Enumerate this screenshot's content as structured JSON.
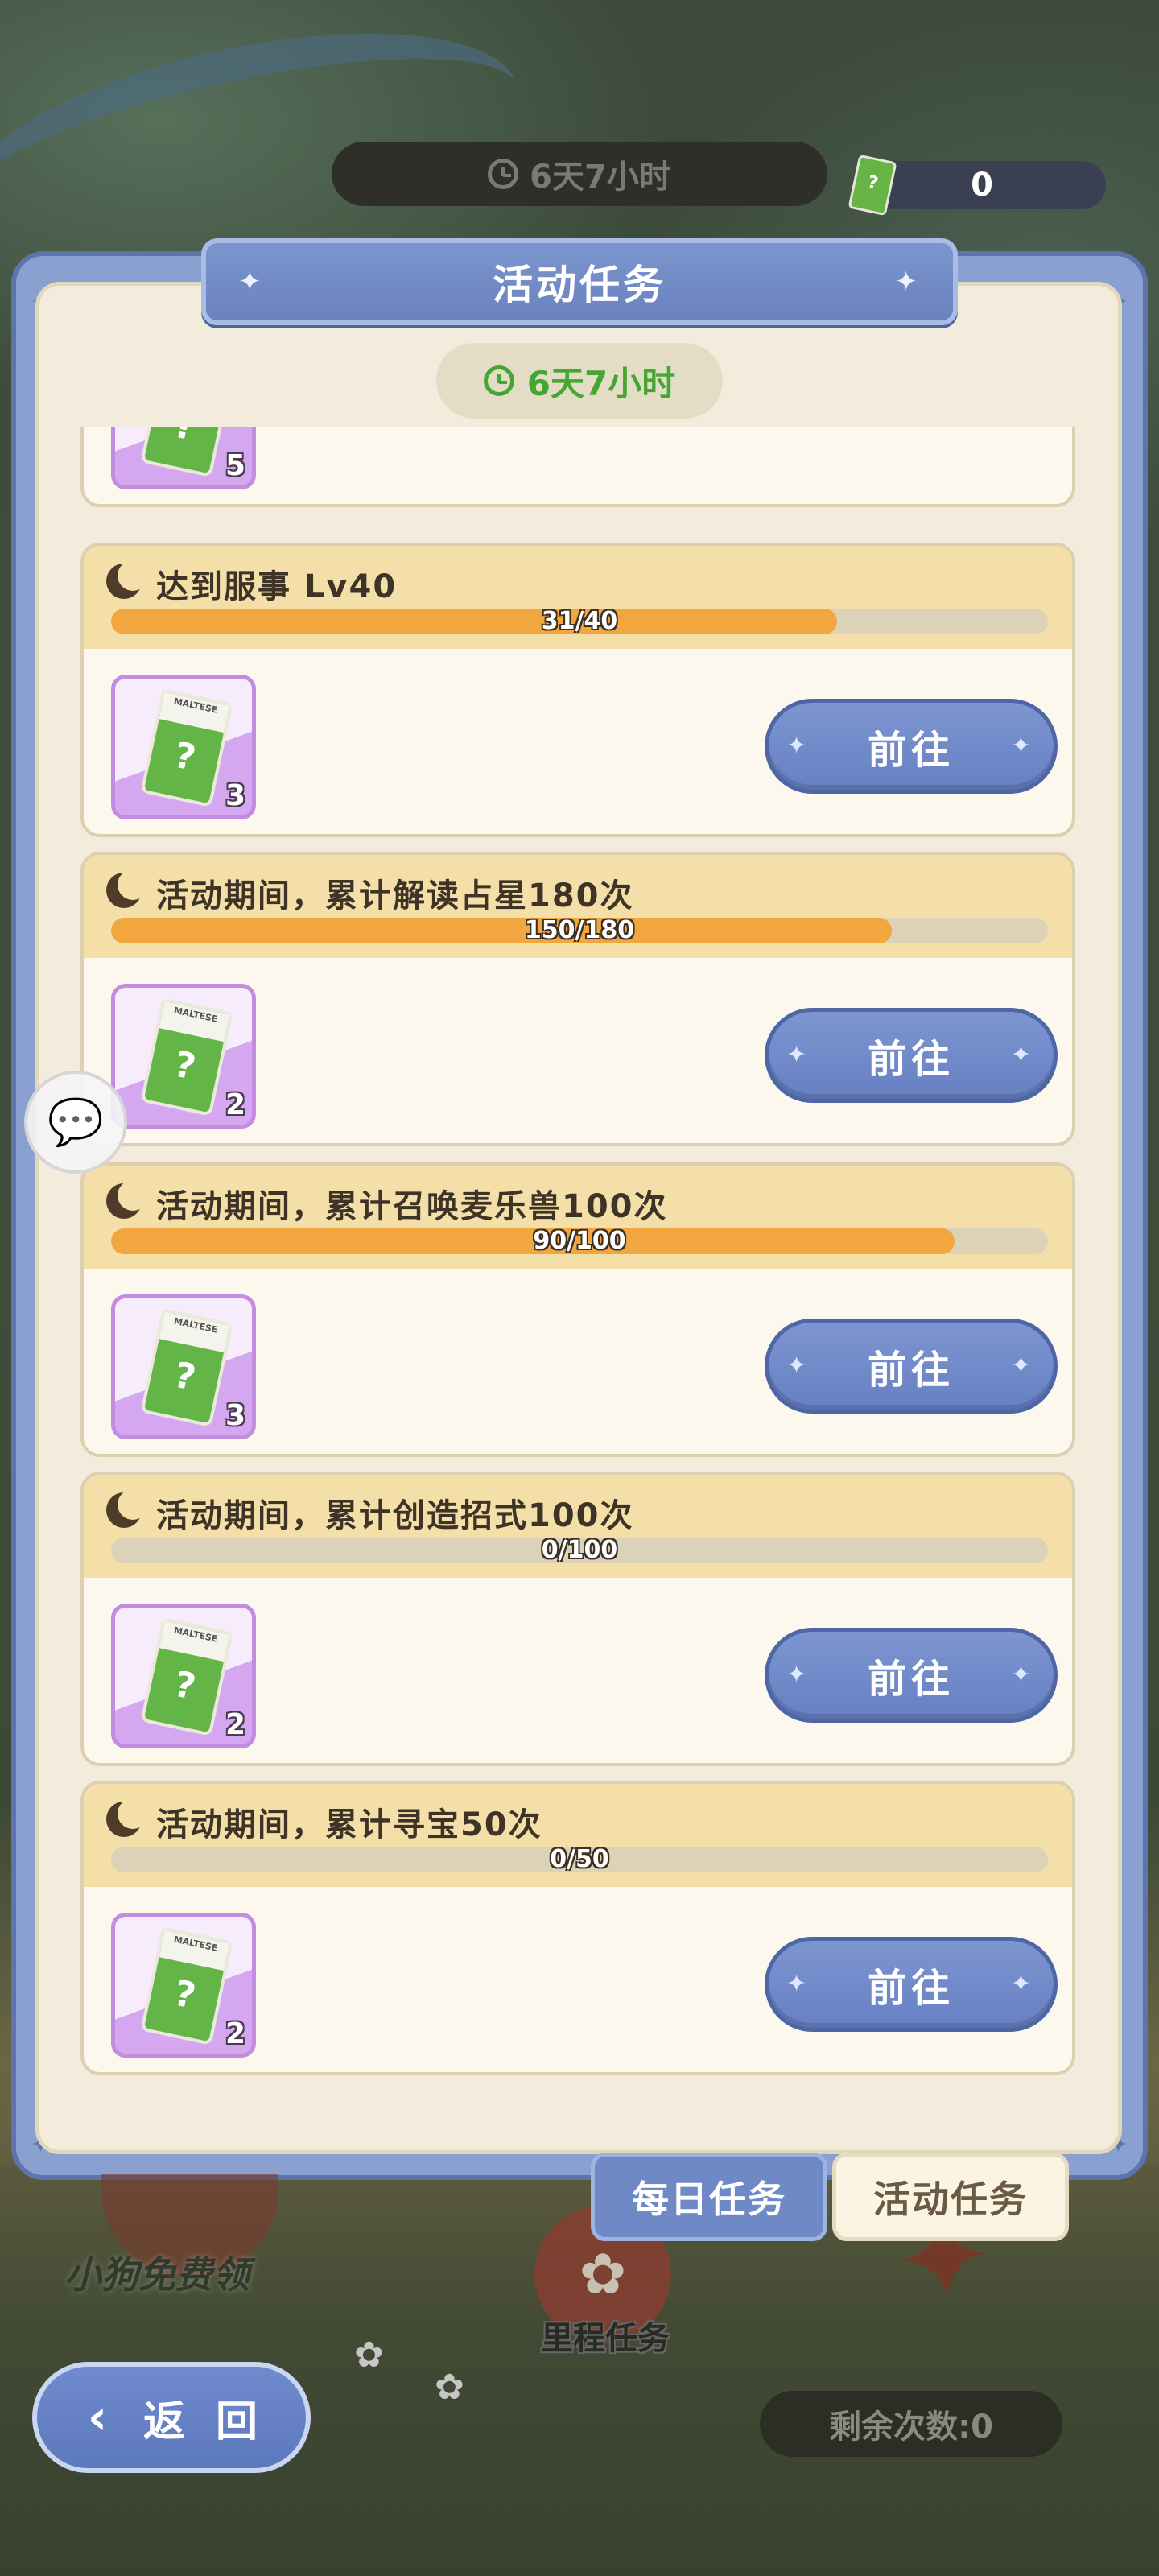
{
  "top_bar": {
    "timer": "6天7小时",
    "currency_value": "0",
    "ticket_glyph": "?"
  },
  "panel": {
    "title": "活动任务",
    "timer": "6天7小时"
  },
  "tasks": [
    {
      "title": "",
      "progress_text": "",
      "progress": 0,
      "reward_count": "5",
      "button": ""
    },
    {
      "title": "达到服事 Lv40",
      "progress_text": "31/40",
      "progress": 0.775,
      "reward_count": "3",
      "button": "前往"
    },
    {
      "title": "活动期间，累计解读占星180次",
      "progress_text": "150/180",
      "progress": 0.833,
      "reward_count": "2",
      "button": "前往"
    },
    {
      "title": "活动期间，累计召唤麦乐兽100次",
      "progress_text": "90/100",
      "progress": 0.9,
      "reward_count": "3",
      "button": "前往"
    },
    {
      "title": "活动期间，累计创造招式100次",
      "progress_text": "0/100",
      "progress": 0,
      "reward_count": "2",
      "button": "前往"
    },
    {
      "title": "活动期间，累计寻宝50次",
      "progress_text": "0/50",
      "progress": 0,
      "reward_count": "2",
      "button": "前往"
    }
  ],
  "reward_ticket": {
    "label": "MALTESE",
    "glyph": "?"
  },
  "tabs": {
    "daily": "每日任务",
    "event": "活动任务",
    "active": "event"
  },
  "background": {
    "free_dog": "小狗免费领",
    "milestone": "里程任务",
    "remaining": "剩余次数:0"
  },
  "back_button": {
    "label": "返 回"
  },
  "colors": {
    "accent_blue": "#6f88c6",
    "progress_fill": "#f2a63f",
    "task_header": "#f5dfa8",
    "timer_green": "#46a633"
  },
  "icons": {
    "clock": "clock-icon",
    "moon": "moon-icon",
    "chat": "chat-icon",
    "back": "back-arrow-icon"
  }
}
